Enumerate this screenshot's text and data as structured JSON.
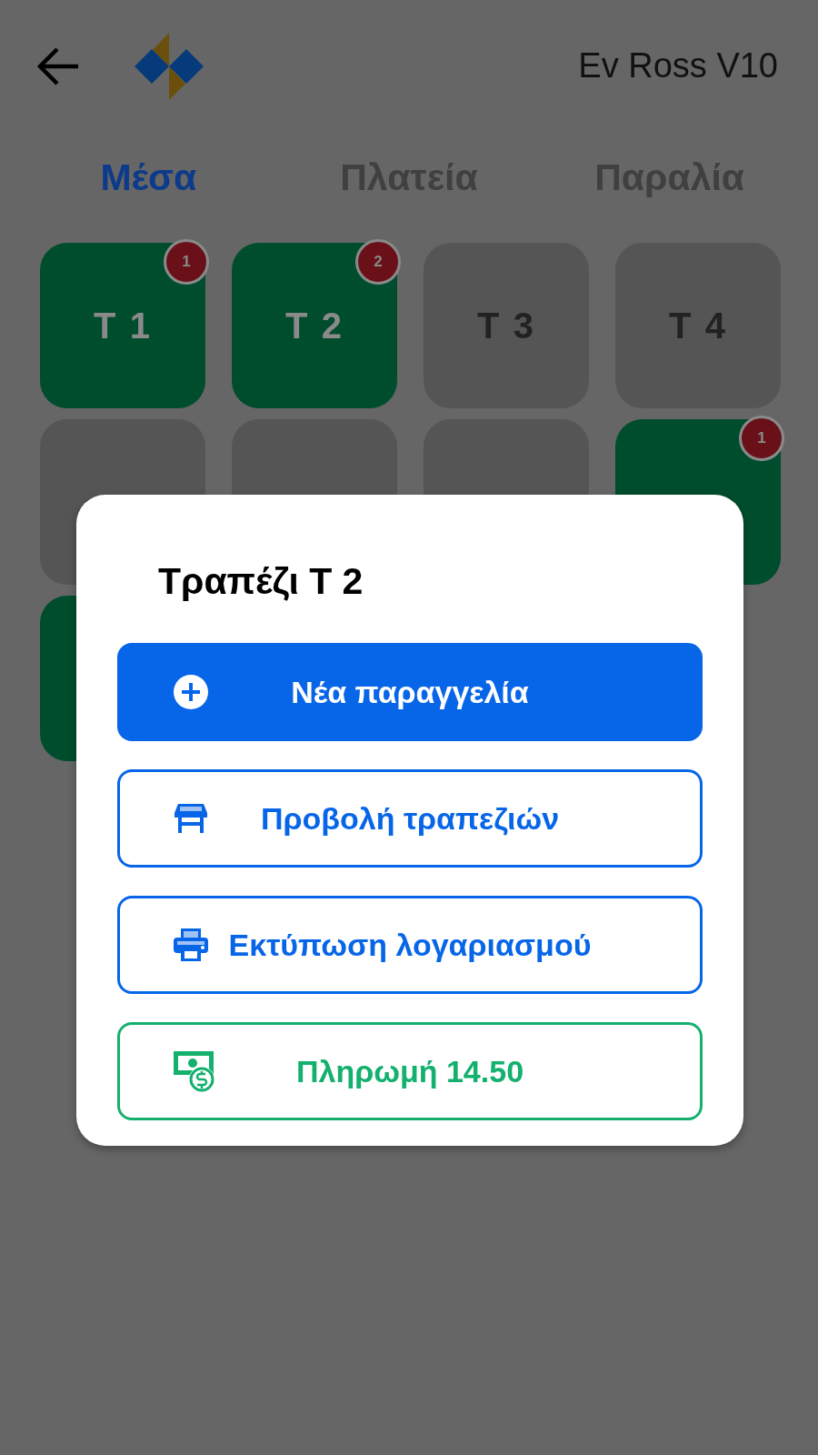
{
  "header": {
    "title": "Ev Ross V10"
  },
  "tabs": [
    {
      "label": "Μέσα",
      "selected": true
    },
    {
      "label": "Πλατεία",
      "selected": false
    },
    {
      "label": "Παραλία",
      "selected": false
    }
  ],
  "tables": [
    {
      "label": "T 1",
      "occupied": true,
      "badge": "1"
    },
    {
      "label": "T 2",
      "occupied": true,
      "badge": "2"
    },
    {
      "label": "T 3",
      "occupied": false
    },
    {
      "label": "T 4",
      "occupied": false
    },
    {
      "occupied": false
    },
    {
      "occupied": false
    },
    {
      "occupied": false
    },
    {
      "occupied": true,
      "badge": "1"
    },
    {
      "occupied": true
    }
  ],
  "dialog": {
    "title": "Τραπέζι Τ 2",
    "actions": [
      {
        "kind": "new_order",
        "label": "Νέα παραγγελία"
      },
      {
        "kind": "view_tables",
        "label": "Προβολή τραπεζιών"
      },
      {
        "kind": "print_bill",
        "label": "Εκτύπωση λογαριασμού"
      },
      {
        "kind": "payment",
        "label": "Πληρωμή 14.50"
      }
    ]
  }
}
